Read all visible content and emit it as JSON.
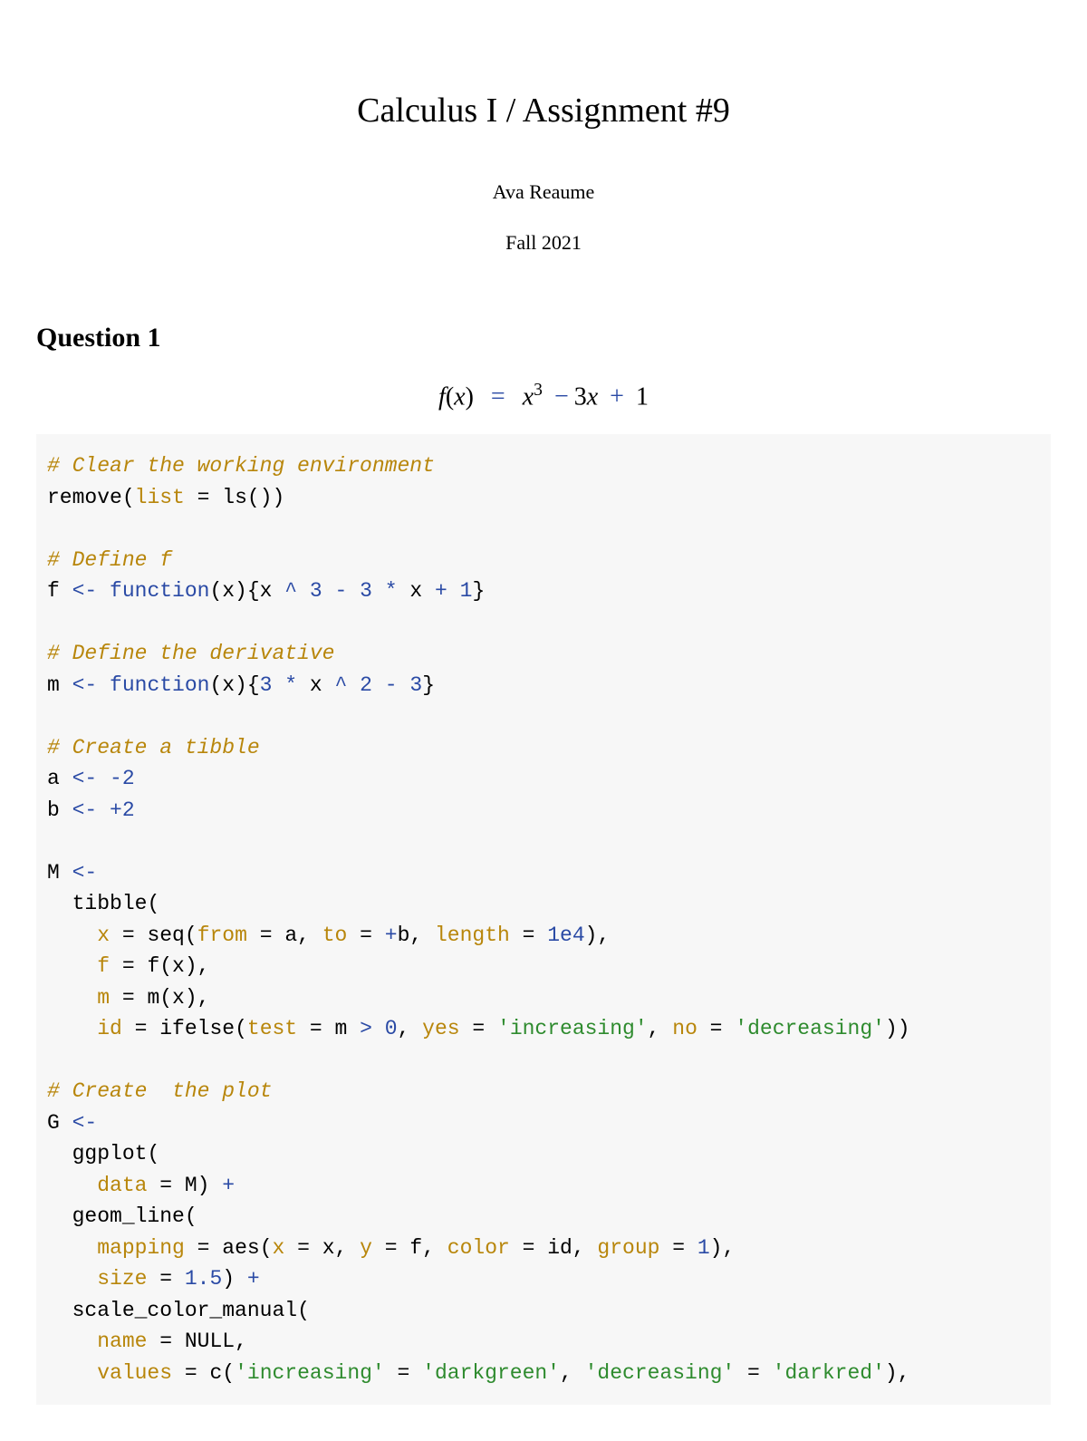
{
  "header": {
    "title": "Calculus I / Assignment #9",
    "author": "Ava Reaume",
    "date": "Fall 2021"
  },
  "section": {
    "heading": "Question 1",
    "equation": {
      "lhs_var": "f",
      "lhs_arg": "x",
      "rhs_var": "x",
      "sup1": "3",
      "minus": "−",
      "coef": "3",
      "var2": "x",
      "plus": "+",
      "const": "1"
    }
  },
  "code": {
    "c1": "# Clear the working environment",
    "l1_fn": "remove",
    "l1_param": "list",
    "l1_eq": " = ",
    "l1_fn2": "ls",
    "l1_call": "()",
    "l1_close": ")",
    "c2": "# Define f",
    "l2_id": "f ",
    "l2_assign": "<-",
    "l2_sp": " ",
    "l2_kw": "function",
    "l2_arg": "(x){x ",
    "l2_op1": "^",
    "l2_sp2": " ",
    "l2_n1": "3",
    "l2_sp3": " ",
    "l2_op2": "-",
    "l2_sp4": " ",
    "l2_n2": "3",
    "l2_sp5": " ",
    "l2_op3": "*",
    "l2_sp6": " x ",
    "l2_op4": "+",
    "l2_sp7": " ",
    "l2_n3": "1",
    "l2_close": "}",
    "c3": "# Define the derivative",
    "l3_id": "m ",
    "l3_assign": "<-",
    "l3_sp": " ",
    "l3_kw": "function",
    "l3_arg": "(x){",
    "l3_n1": "3",
    "l3_sp2": " ",
    "l3_op1": "*",
    "l3_sp3": " x ",
    "l3_op2": "^",
    "l3_sp4": " ",
    "l3_n2": "2",
    "l3_sp5": " ",
    "l3_op3": "-",
    "l3_sp6": " ",
    "l3_n3": "3",
    "l3_close": "}",
    "c4": "# Create a tibble",
    "l4_id": "a ",
    "l4_assign": "<-",
    "l4_sp": " ",
    "l4_op": "-",
    "l4_n": "2",
    "l5_id": "b ",
    "l5_assign": "<-",
    "l5_sp": " ",
    "l5_op": "+",
    "l5_n": "2",
    "l6_id": "M ",
    "l6_assign": "<-",
    "l7_indent": "  ",
    "l7_fn": "tibble",
    "l7_open": "(",
    "l8_indent": "    ",
    "l8_param": "x",
    "l8_eq": " = ",
    "l8_fn": "seq",
    "l8_open": "(",
    "l8_p1": "from",
    "l8_eq1": " = a, ",
    "l8_p2": "to",
    "l8_eq2": " = ",
    "l8_op": "+",
    "l8_b": "b, ",
    "l8_p3": "length",
    "l8_eq3": " = ",
    "l8_n": "1e4",
    "l8_close": "),",
    "l9_indent": "    ",
    "l9_param": "f",
    "l9_eq": " = ",
    "l9_call": "f(x),",
    "l10_indent": "    ",
    "l10_param": "m",
    "l10_eq": " = ",
    "l10_call": "m(x),",
    "l11_indent": "    ",
    "l11_param": "id",
    "l11_eq": " = ",
    "l11_fn": "ifelse",
    "l11_open": "(",
    "l11_p1": "test",
    "l11_eq1": " = m ",
    "l11_op": ">",
    "l11_sp": " ",
    "l11_n": "0",
    "l11_comma": ", ",
    "l11_p2": "yes",
    "l11_eq2": " = ",
    "l11_s1": "'increasing'",
    "l11_comma2": ", ",
    "l11_p3": "no",
    "l11_eq3": " = ",
    "l11_s2": "'decreasing'",
    "l11_close": "))",
    "c5": "# Create  the plot",
    "l12_id": "G ",
    "l12_assign": "<-",
    "l13_indent": "  ",
    "l13_fn": "ggplot",
    "l13_open": "(",
    "l14_indent": "    ",
    "l14_param": "data",
    "l14_eq": " = M) ",
    "l14_op": "+",
    "l15_indent": "  ",
    "l15_fn": "geom_line",
    "l15_open": "(",
    "l16_indent": "    ",
    "l16_param": "mapping",
    "l16_eq": " = ",
    "l16_fn": "aes",
    "l16_open": "(",
    "l16_p1": "x",
    "l16_eq1": " = x, ",
    "l16_p2": "y",
    "l16_eq2": " = f, ",
    "l16_p3": "color",
    "l16_eq3": " = id, ",
    "l16_p4": "group",
    "l16_eq4": " = ",
    "l16_n": "1",
    "l16_close": "),",
    "l17_indent": "    ",
    "l17_param": "size",
    "l17_eq": " = ",
    "l17_n": "1.5",
    "l17_close": ") ",
    "l17_op": "+",
    "l18_indent": "  ",
    "l18_fn": "scale_color_manual",
    "l18_open": "(",
    "l19_indent": "    ",
    "l19_param": "name",
    "l19_eq": " = ",
    "l19_null": "NULL",
    "l19_comma": ",",
    "l20_indent": "    ",
    "l20_param": "values",
    "l20_eq": " = ",
    "l20_fn": "c",
    "l20_open": "(",
    "l20_s1": "'increasing'",
    "l20_eq1": " = ",
    "l20_s2": "'darkgreen'",
    "l20_comma": ", ",
    "l20_s3": "'decreasing'",
    "l20_eq2": " = ",
    "l20_s4": "'darkred'",
    "l20_close": "),"
  }
}
